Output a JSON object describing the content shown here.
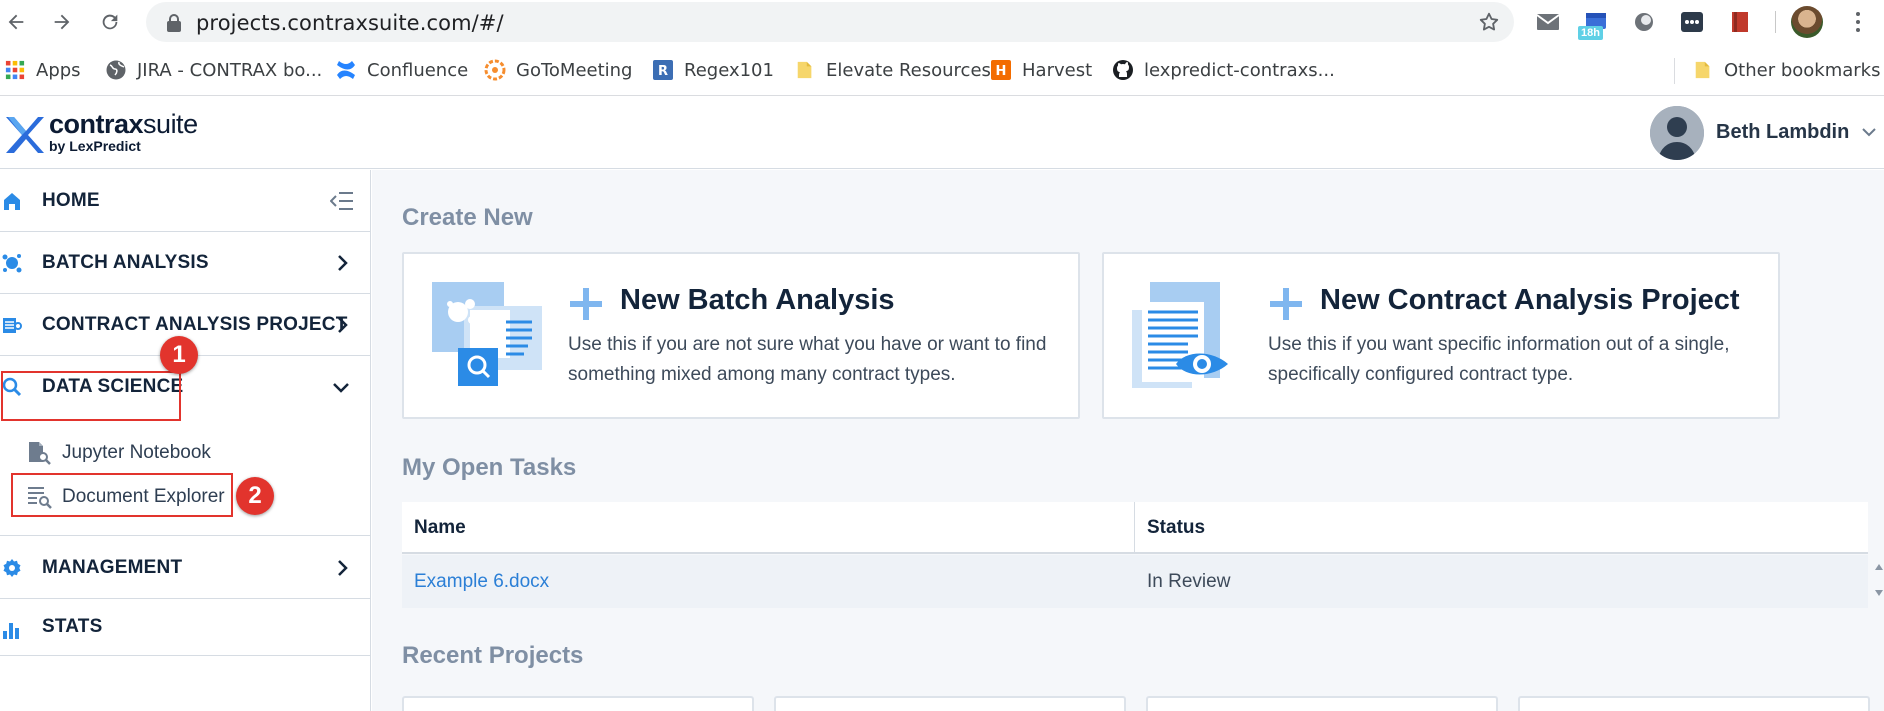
{
  "browser": {
    "url": "projects.contraxsuite.com/#/",
    "extension_badge": "18h",
    "bookmarks": [
      {
        "label": "Apps",
        "icon": "apps-grid-icon"
      },
      {
        "label": "JIRA - CONTRAX bo...",
        "icon": "globe-icon"
      },
      {
        "label": "Confluence",
        "icon": "confluence-icon"
      },
      {
        "label": "GoToMeeting",
        "icon": "gotomeeting-icon"
      },
      {
        "label": "Regex101",
        "icon": "regex101-icon"
      },
      {
        "label": "Elevate Resources",
        "icon": "folder-icon"
      },
      {
        "label": "Harvest",
        "icon": "harvest-icon"
      },
      {
        "label": "lexpredict-contraxs...",
        "icon": "github-icon"
      }
    ],
    "other_bookmarks": "Other bookmarks"
  },
  "app": {
    "brand_bold": "contrax",
    "brand_light": "suite",
    "brand_sub": "by LexPredict",
    "user_name": "Beth Lambdin",
    "accent_color": "#2b8be6"
  },
  "sidebar": {
    "items": [
      {
        "label": "HOME",
        "icon": "home-icon"
      },
      {
        "label": "BATCH ANALYSIS",
        "icon": "batch-analysis-icon"
      },
      {
        "label": "CONTRACT ANALYSIS PROJECT",
        "icon": "contract-analysis-icon"
      },
      {
        "label": "DATA SCIENCE",
        "icon": "search-icon",
        "expanded": true
      },
      {
        "label": "MANAGEMENT",
        "icon": "gear-icon"
      },
      {
        "label": "STATS",
        "icon": "bar-chart-icon"
      }
    ],
    "data_science_children": [
      {
        "label": "Jupyter Notebook",
        "icon": "notebook-icon"
      },
      {
        "label": "Document Explorer",
        "icon": "document-explorer-icon"
      }
    ]
  },
  "callouts": [
    "1",
    "2"
  ],
  "main": {
    "create_new_title": "Create New",
    "cards": [
      {
        "title": "New Batch Analysis",
        "description": "Use this if you are not sure what you have or want to find something mixed among many contract types."
      },
      {
        "title": "New Contract Analysis Project",
        "description": "Use this if you want specific information out of a single, specifically configured contract type."
      }
    ],
    "open_tasks_title": "My Open Tasks",
    "tasks": {
      "columns": [
        "Name",
        "Status"
      ],
      "rows": [
        {
          "name": "Example 6.docx",
          "status": "In Review"
        }
      ]
    },
    "recent_projects_title": "Recent Projects"
  }
}
